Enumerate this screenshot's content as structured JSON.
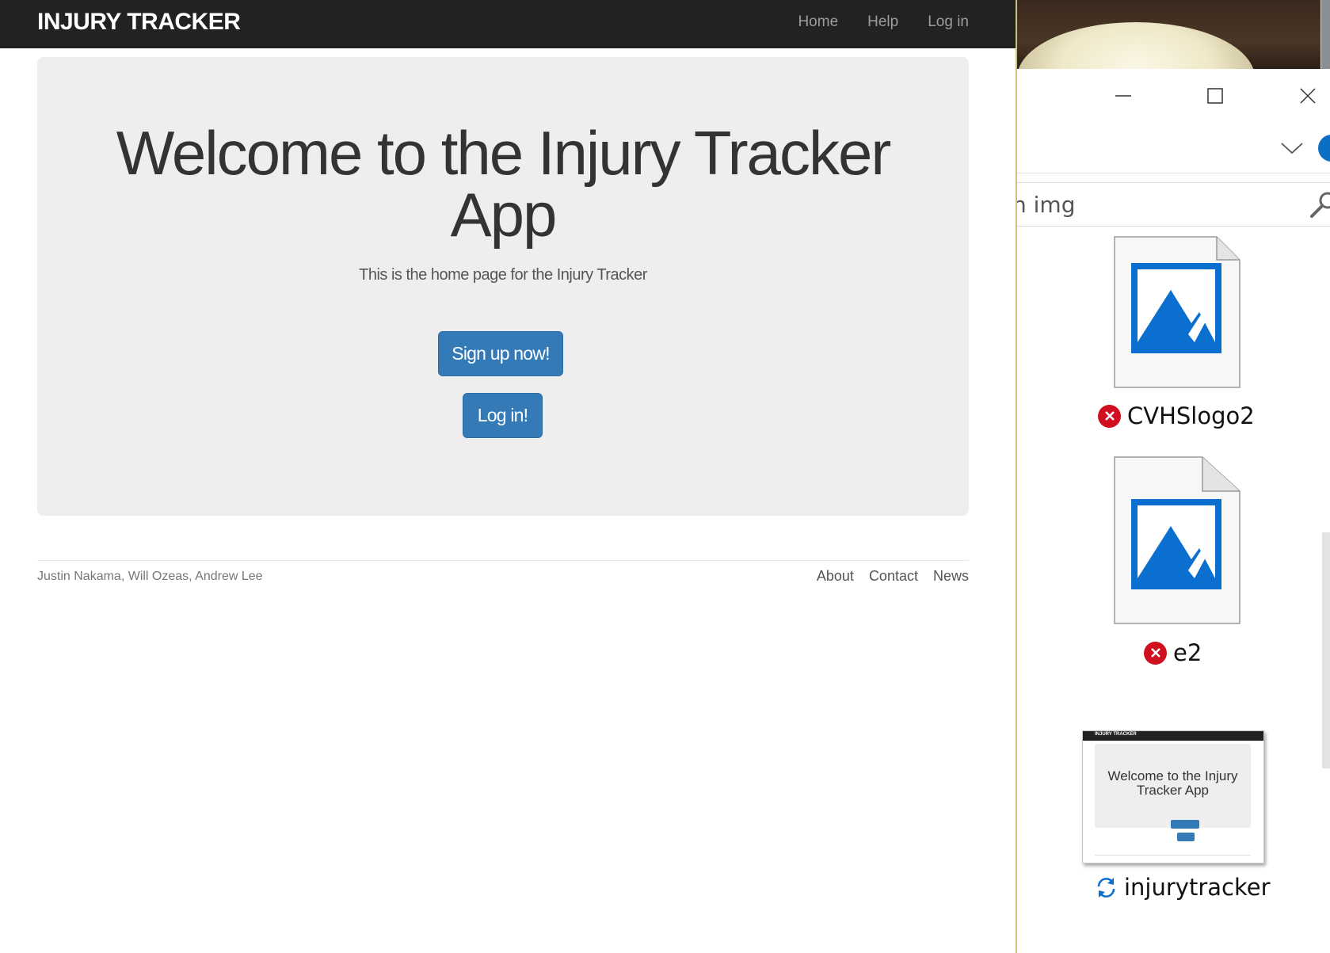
{
  "browser_page": {
    "navbar": {
      "brand": "INJURY TRACKER",
      "links": [
        "Home",
        "Help",
        "Log in"
      ]
    },
    "jumbotron": {
      "title": "Welcome to the Injury Tracker App",
      "subtitle": "This is the home page for the Injury Tracker",
      "signup_label": "Sign up now!",
      "login_label": "Log in!"
    },
    "footer": {
      "credits": "Justin Nakama, Will Ozeas, Andrew Lee",
      "links": [
        "About",
        "Contact",
        "News"
      ]
    }
  },
  "explorer": {
    "search_value": "n img",
    "files": [
      {
        "name": "CVHSlogo2",
        "status": "error-icon",
        "icon": "image-file-icon"
      },
      {
        "name": "e2",
        "status": "error-icon",
        "icon": "image-file-icon"
      },
      {
        "name": "injurytracker",
        "status": "sync-icon",
        "icon": "thumbnail"
      }
    ],
    "thumbnail": {
      "brand": "INJURY TRACKER",
      "title": "Welcome to the Injury Tracker App"
    },
    "colors": {
      "accent": "#0078d7",
      "error": "#d0101e",
      "button": "#337ab7",
      "navbar": "#222222"
    }
  }
}
